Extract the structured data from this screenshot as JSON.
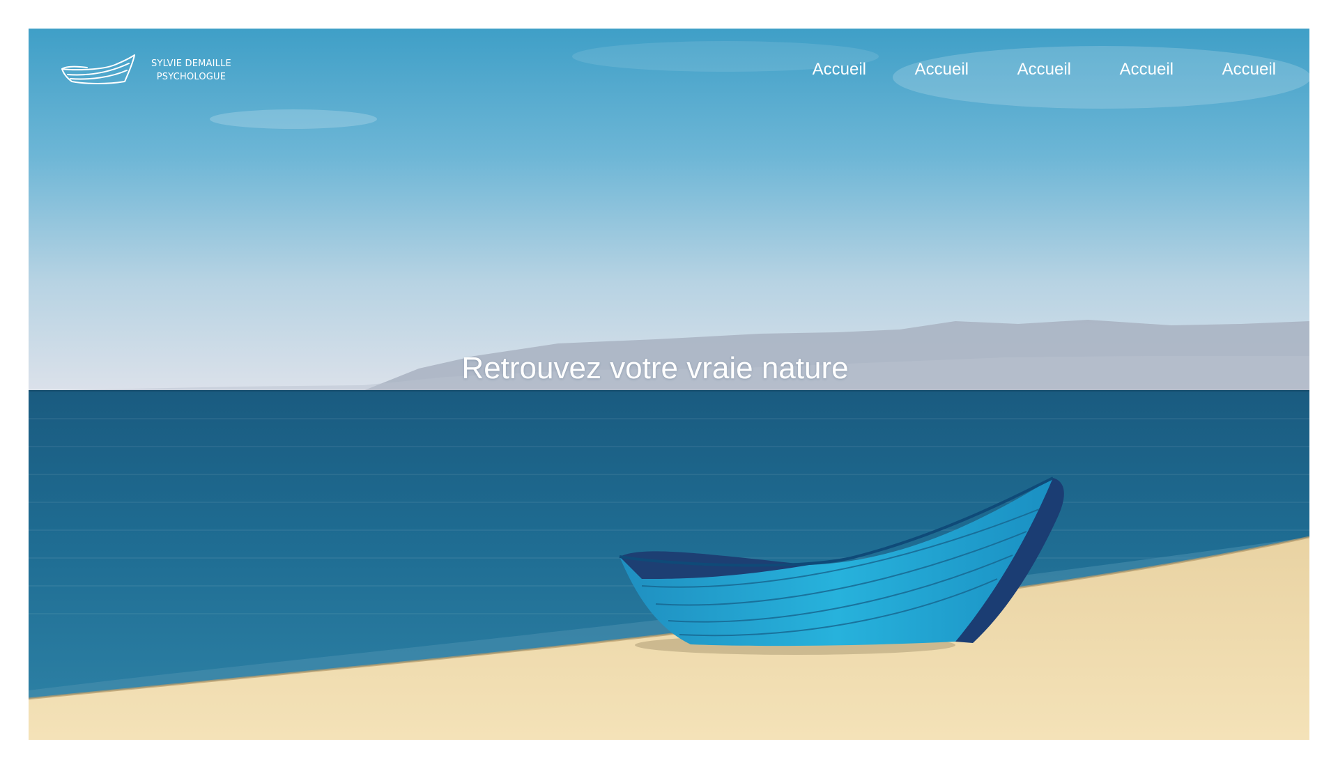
{
  "brand": {
    "name_line1": "SYLVIE DEMAILLE",
    "name_line2": "PSYCHOLOGUE",
    "icon": "boat-logo-icon"
  },
  "nav": {
    "items": [
      {
        "label": "Accueil"
      },
      {
        "label": "Accueil"
      },
      {
        "label": "Accueil"
      },
      {
        "label": "Accueil"
      },
      {
        "label": "Accueil"
      }
    ]
  },
  "hero": {
    "title": "Retrouvez votre vraie nature"
  },
  "colors": {
    "sky_top": "#4aa6cb",
    "sky_horizon": "#d6dfe8",
    "sea_deep": "#1b5f84",
    "sand": "#f3dfb3",
    "boat": "#22a9d6",
    "text": "#ffffff"
  }
}
